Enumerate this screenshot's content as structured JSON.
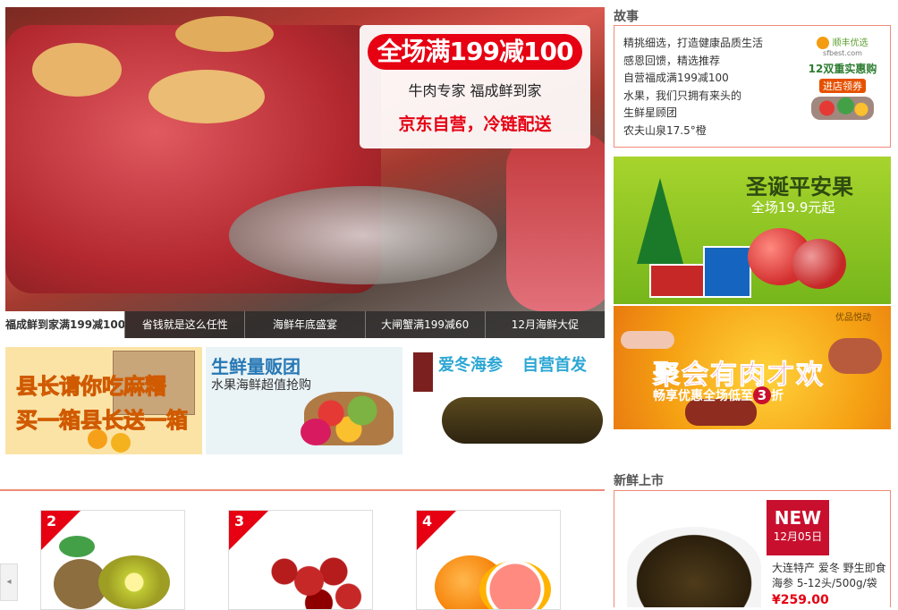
{
  "hero": {
    "promo_title": "全场满199减100",
    "promo_line2": "牛肉专家 福成鲜到家",
    "promo_line3": "京东自营，冷链配送",
    "tabs": [
      "福成鲜到家满199减100",
      "省钱就是这么任性",
      "海鲜年底盛宴",
      "大闸蟹满199减60",
      "12月海鲜大促"
    ],
    "active_tab": 0
  },
  "banners": {
    "b1_line1": "县长请你吃麻糬",
    "b1_line2": "买一箱县长送一箱",
    "b2_title": "生鲜量贩团",
    "b2_sub": "水果海鲜超值抢购",
    "b3_title": "爱冬海参",
    "b3_sub": "自营首发"
  },
  "story": {
    "heading": "故事",
    "lines": [
      "精挑细选，打造健康品质生活",
      "感恩回馈，精选推荐",
      "自营福成满199减100",
      "水果，我们只拥有来头的",
      "生鲜星顾团",
      "农夫山泉17.5°橙"
    ],
    "ad_brand": "顺丰优选",
    "ad_brand_url": "sfbest.com",
    "ad_line1": "12双重实惠购",
    "ad_line2": "进店领券"
  },
  "xmas": {
    "title": "圣诞平安果",
    "sub": "全场19.9元起"
  },
  "party": {
    "brand": "优品悦动",
    "title": "聚会有肉才欢",
    "sub_prefix": "畅享优惠全场低至",
    "sub_num": "3",
    "sub_suffix": "折"
  },
  "fresh": {
    "heading": "新鲜上市",
    "badge_title": "NEW",
    "badge_date": "12月05日",
    "desc": "大连特产 爱冬 野生即食海参 5-12头/500g/袋",
    "price": "¥259.00"
  },
  "products": [
    {
      "rank": "2"
    },
    {
      "rank": "3"
    },
    {
      "rank": "4"
    }
  ],
  "colors": {
    "accent": "#e60012",
    "border": "#f08a78"
  }
}
